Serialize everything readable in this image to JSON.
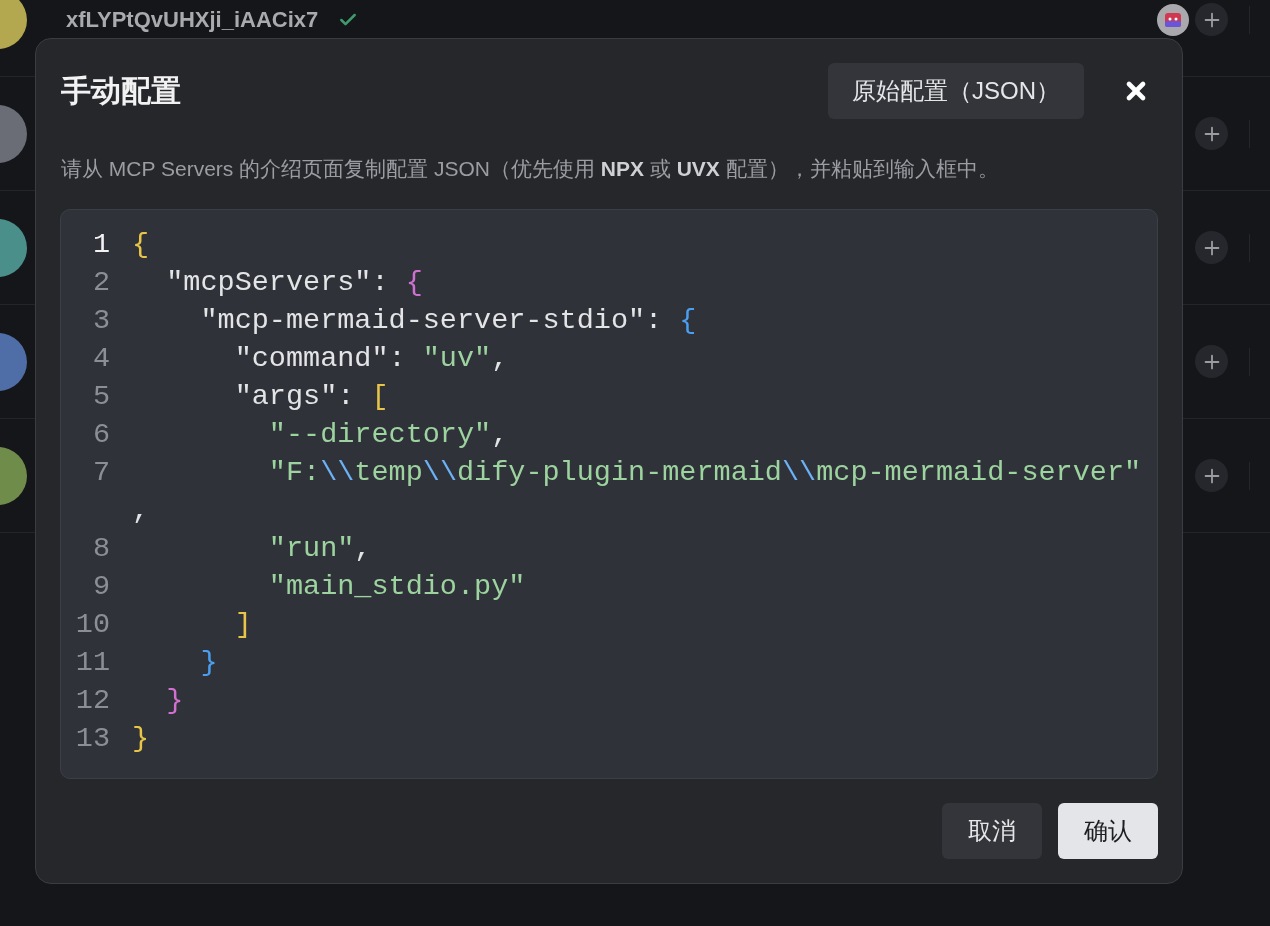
{
  "background_list": {
    "rows": [
      {
        "title": "xfLYPtQvUHXji_iAACix7",
        "verified": true,
        "app_icon": true,
        "color": "#b3a84f"
      },
      {
        "color": "#6a6d76"
      },
      {
        "color": "#4b8f8b"
      },
      {
        "color": "#4f6da6"
      },
      {
        "color": "#6f8c4b"
      }
    ]
  },
  "dialog": {
    "title": "手动配置",
    "raw_button": "原始配置（JSON）",
    "description": "请从 MCP Servers 的介绍页面复制配置 JSON（优先使用 **NPX** 或 **UVX** 配置），并粘贴到输入框中。",
    "editor": {
      "lines": [
        {
          "number": "1",
          "current": true,
          "tokens": [
            {
              "kind": "bracket",
              "text": "{",
              "color": "#e8c547"
            }
          ]
        },
        {
          "number": "2",
          "current": false,
          "tokens": [
            {
              "kind": "text",
              "text": "  \"mcpServers\": "
            },
            {
              "kind": "bracket",
              "text": "{",
              "color": "#d070d0"
            }
          ]
        },
        {
          "number": "3",
          "current": false,
          "tokens": [
            {
              "kind": "text",
              "text": "    \"mcp-mermaid-server-stdio\": "
            },
            {
              "kind": "bracket",
              "text": "{",
              "color": "#4a9ff0"
            }
          ]
        },
        {
          "number": "4",
          "current": false,
          "tokens": [
            {
              "kind": "text",
              "text": "      \"command\": "
            },
            {
              "kind": "string",
              "text": "\"uv\""
            },
            {
              "kind": "text",
              "text": ","
            }
          ]
        },
        {
          "number": "5",
          "current": false,
          "tokens": [
            {
              "kind": "text",
              "text": "      \"args\": "
            },
            {
              "kind": "bracket",
              "text": "[",
              "color": "#e8c547"
            }
          ]
        },
        {
          "number": "6",
          "current": false,
          "tokens": [
            {
              "kind": "string",
              "text": "        \"--directory\""
            },
            {
              "kind": "text",
              "text": ","
            }
          ]
        },
        {
          "number": "7",
          "current": false,
          "tokens": [
            {
              "kind": "string",
              "text": "        \"F:"
            },
            {
              "kind": "escape",
              "text": "\\\\"
            },
            {
              "kind": "string",
              "text": "temp"
            },
            {
              "kind": "escape",
              "text": "\\\\"
            },
            {
              "kind": "string",
              "text": "dify-plugin-mermaid"
            },
            {
              "kind": "escape",
              "text": "\\\\"
            },
            {
              "kind": "string",
              "text": "mcp-mermaid-server\""
            },
            {
              "kind": "text",
              "text": ","
            }
          ]
        },
        {
          "number": "8",
          "current": false,
          "tokens": [
            {
              "kind": "string",
              "text": "        \"run\""
            },
            {
              "kind": "text",
              "text": ","
            }
          ]
        },
        {
          "number": "9",
          "current": false,
          "tokens": [
            {
              "kind": "string",
              "text": "        \"main_stdio.py\""
            }
          ]
        },
        {
          "number": "10",
          "current": false,
          "tokens": [
            {
              "kind": "bracket",
              "text": "      ]",
              "color": "#e8c547"
            }
          ]
        },
        {
          "number": "11",
          "current": false,
          "tokens": [
            {
              "kind": "bracket",
              "text": "    }",
              "color": "#4a9ff0"
            }
          ]
        },
        {
          "number": "12",
          "current": false,
          "tokens": [
            {
              "kind": "bracket",
              "text": "  }",
              "color": "#d070d0"
            }
          ]
        },
        {
          "number": "13",
          "current": false,
          "tokens": [
            {
              "kind": "bracket",
              "text": "}",
              "color": "#e8c547"
            }
          ]
        }
      ]
    },
    "buttons": [
      {
        "label": "取消",
        "kind": "secondary"
      },
      {
        "label": "确认",
        "kind": "primary"
      }
    ]
  }
}
